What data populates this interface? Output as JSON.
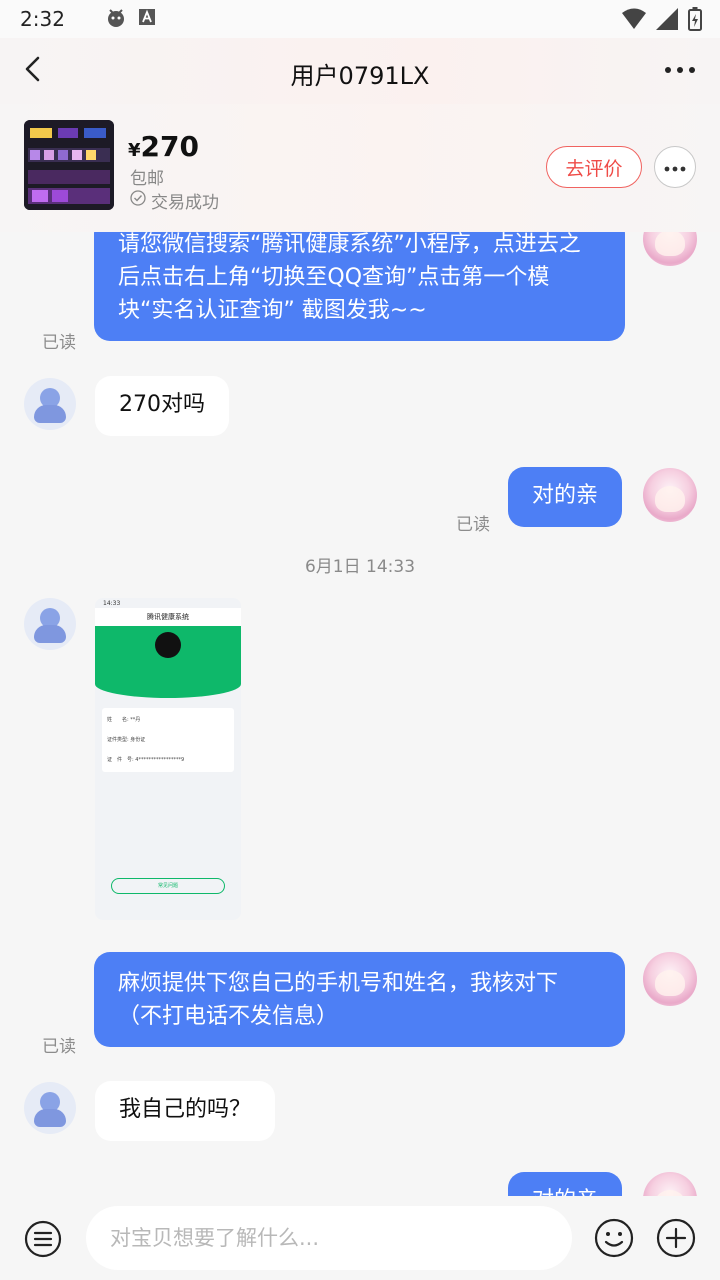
{
  "status_bar": {
    "time": "2:32",
    "icons": [
      "android-debug-icon",
      "keyboard-a-icon",
      "wifi-icon",
      "signal-icon",
      "battery-charging-icon"
    ]
  },
  "header": {
    "title": "用户0791LX",
    "back_icon": "chevron-left-icon",
    "more_icon": "ellipsis-icon"
  },
  "product": {
    "currency": "¥",
    "price": "270",
    "shipping": "包邮",
    "status": "交易成功",
    "review_button": "去评价"
  },
  "messages": {
    "m1": {
      "text": "请您微信搜索“腾讯健康系统”小程序，点进去之后点击右上角“切换至QQ查询”点击第一个模块“实名认证查询” 截图发我~~",
      "read": "已读"
    },
    "m2": {
      "text": "270对吗"
    },
    "m3": {
      "text": "对的亲",
      "read": "已读"
    },
    "timestamp": "6月1日 14:33",
    "m5": {
      "text": "麻烦提供下您自己的手机号和姓名，我核对下（不打电话不发信息）",
      "read": "已读"
    },
    "m6": {
      "text": "我自己的吗？"
    },
    "m7": {
      "text": "对的亲"
    }
  },
  "screenshot": {
    "time": "14:33",
    "title": "腾讯健康系统",
    "name_label": "姓　　名:",
    "name_value": "**丹",
    "id_type_label": "证件类型:",
    "id_type_value": "身份证",
    "id_no_label": "证　件　号:",
    "id_no_value": "4*****************9",
    "faq_button": "常见问题"
  },
  "input": {
    "placeholder": "对宝贝想要了解什么..."
  },
  "colors": {
    "accent": "#4d7ff5",
    "review": "#ef4b47",
    "green": "#0eb86a"
  }
}
